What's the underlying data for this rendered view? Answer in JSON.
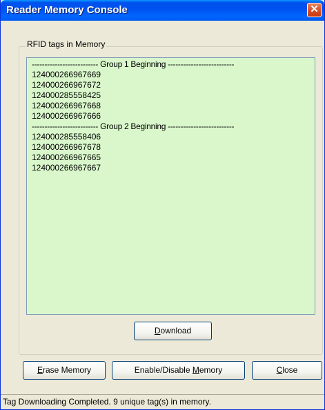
{
  "window": {
    "title": "Reader Memory Console",
    "close_glyph": "✕"
  },
  "group": {
    "legend": "RFID tags in Memory"
  },
  "tag_list": [
    {
      "text": "-------------------------- Group 1 Beginning --------------------------",
      "kind": "header"
    },
    {
      "text": "124000266967669",
      "kind": "tag"
    },
    {
      "text": "124000266967672",
      "kind": "tag"
    },
    {
      "text": "124000285558425",
      "kind": "tag"
    },
    {
      "text": "124000266967668",
      "kind": "tag"
    },
    {
      "text": "124000266967666",
      "kind": "tag"
    },
    {
      "text": "-------------------------- Group 2 Beginning --------------------------",
      "kind": "header"
    },
    {
      "text": "124000285558406",
      "kind": "tag"
    },
    {
      "text": "124000266967678",
      "kind": "tag"
    },
    {
      "text": "124000266967665",
      "kind": "tag"
    },
    {
      "text": "124000266967667",
      "kind": "tag"
    }
  ],
  "buttons": {
    "download": {
      "pre": "",
      "mnemonic": "D",
      "post": "ownload"
    },
    "erase": {
      "pre": "",
      "mnemonic": "E",
      "post": "rase Memory"
    },
    "enable_disable": {
      "pre": "Enable/Disable ",
      "mnemonic": "M",
      "post": "emory"
    },
    "close": {
      "pre": "",
      "mnemonic": "C",
      "post": "lose"
    }
  },
  "status": {
    "text": "Tag Downloading Completed. 9 unique tag(s) in memory."
  },
  "colors": {
    "list_background": "#d9f7cb",
    "titlebar": "#0050ee",
    "window_face": "#ece9d8"
  }
}
